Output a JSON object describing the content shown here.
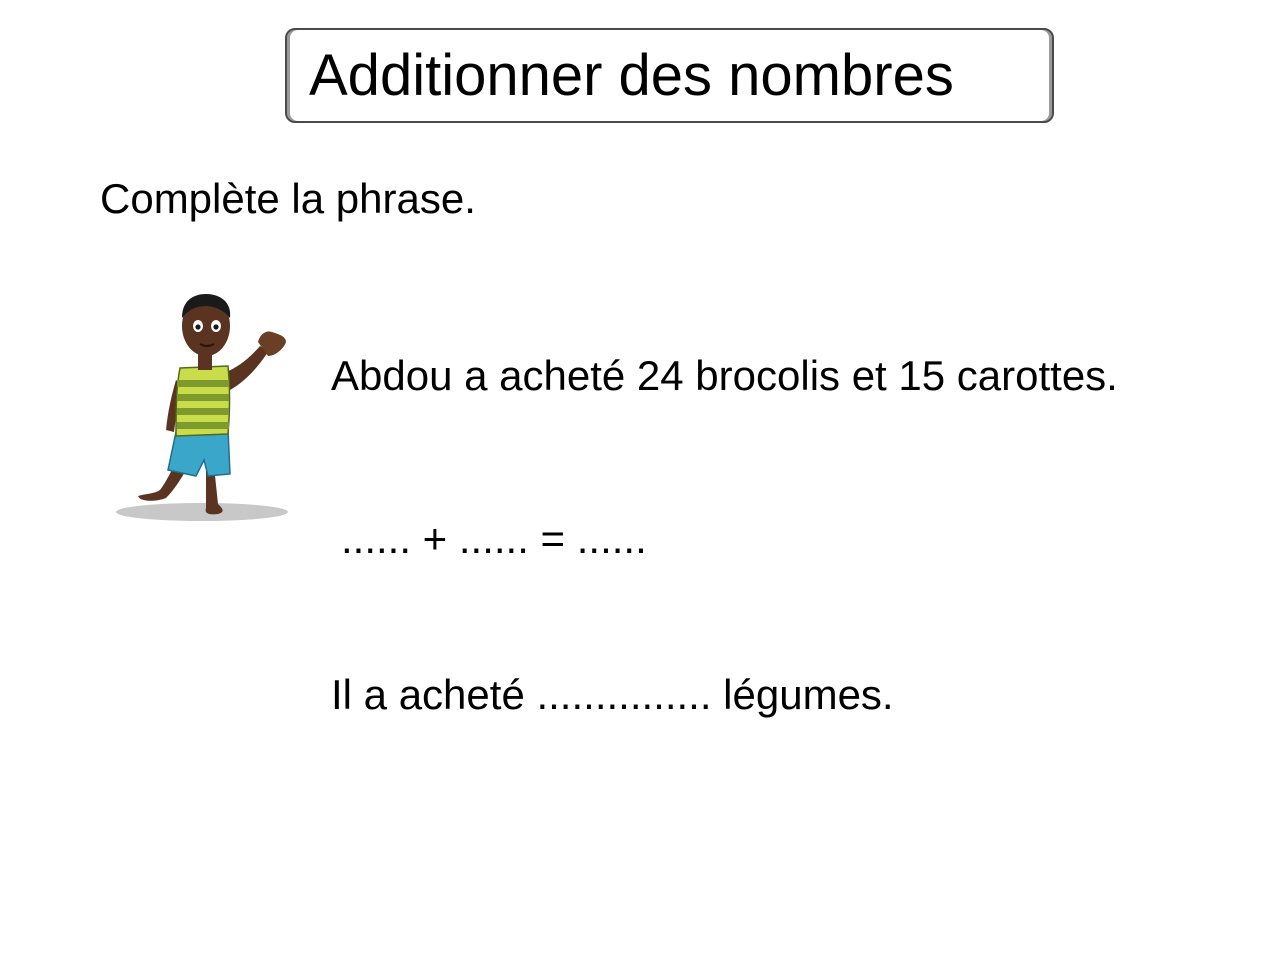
{
  "title": "Additionner des nombres",
  "instruction": "Complète la phrase.",
  "exercise": {
    "statement": "Abdou a acheté 24 brocolis et 15 carottes.",
    "equation": "...... + ...... = ......",
    "answer_sentence": "Il a acheté ............... légumes."
  },
  "illustration": {
    "icon": "waving-boy-illustration",
    "colors": {
      "skin": "#5a3420",
      "shirt_light": "#c9dc4a",
      "shirt_dark": "#7e9a2c",
      "shorts": "#3aa6c9",
      "shadow": "#c8c8c8"
    }
  }
}
